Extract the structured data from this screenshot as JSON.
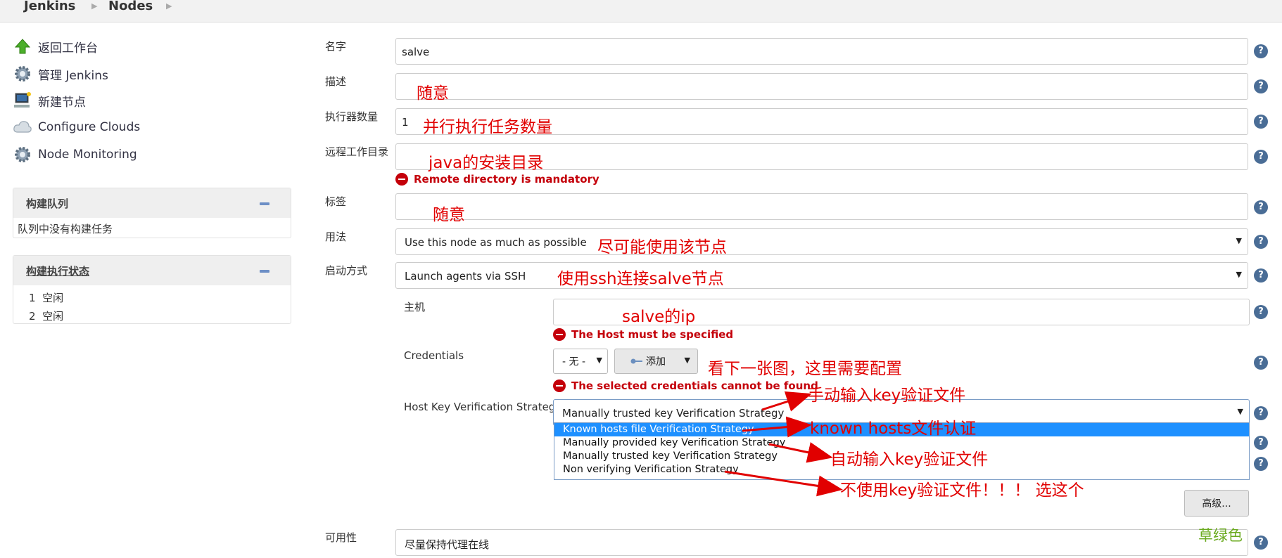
{
  "breadcrumb": {
    "root": "Jenkins",
    "current": "Nodes"
  },
  "sidebar": {
    "items": [
      {
        "label": "返回工作台",
        "icon": "up-arrow-icon"
      },
      {
        "label": "管理 Jenkins",
        "icon": "gear-icon"
      },
      {
        "label": "新建节点",
        "icon": "computer-icon"
      },
      {
        "label": "Configure Clouds",
        "icon": "cloud-icon"
      },
      {
        "label": "Node Monitoring",
        "icon": "gear-icon"
      }
    ],
    "build_queue": {
      "title": "构建队列",
      "empty_text": "队列中没有构建任务"
    },
    "executor_status": {
      "title": "构建执行状态",
      "executors": [
        {
          "num": "1",
          "status": "空闲"
        },
        {
          "num": "2",
          "status": "空闲"
        }
      ]
    }
  },
  "form": {
    "name": {
      "label": "名字",
      "value": "salve"
    },
    "description": {
      "label": "描述",
      "value": ""
    },
    "executors": {
      "label": "执行器数量",
      "value": "1"
    },
    "remote_dir": {
      "label": "远程工作目录",
      "value": "",
      "error": "Remote directory is mandatory"
    },
    "labels": {
      "label": "标签",
      "value": ""
    },
    "usage": {
      "label": "用法",
      "value": "Use this node as much as possible"
    },
    "launch": {
      "label": "启动方式",
      "value": "Launch agents via SSH"
    },
    "host": {
      "label": "主机",
      "value": "",
      "error": "The Host must be specified"
    },
    "credentials": {
      "label": "Credentials",
      "value": "- 无 -",
      "add_label": "添加",
      "error": "The selected credentials cannot be found"
    },
    "host_key": {
      "label": "Host Key Verification Strategy",
      "value": "Manually trusted key Verification Strategy",
      "options": [
        "Known hosts file Verification Strategy",
        "Manually provided key Verification Strategy",
        "Manually trusted key Verification Strategy",
        "Non verifying Verification Strategy"
      ],
      "highlighted_option": 0
    },
    "advanced_label": "高级...",
    "availability": {
      "label": "可用性",
      "value": "尽量保持代理在线"
    }
  },
  "annotations": {
    "description": "随意",
    "executors": "并行执行任务数量",
    "remote_dir": "java的安装目录",
    "labels": "随意",
    "usage": "尽可能使用该节点",
    "launch": "使用ssh连接salve节点",
    "host": "salve的ip",
    "credentials": "看下一张图，这里需要配置",
    "manual_trusted": "手动输入key验证文件",
    "known_hosts": "known hosts文件认证",
    "manual_provided": "自动输入key验证文件",
    "non_verifying": "不使用key验证文件！！！ 选这个",
    "watermark": "草绿色"
  },
  "colors": {
    "annotation": "#e10000",
    "highlight": "#1e90ff",
    "error": "#c4000a",
    "watermark": "#6aaa1e"
  }
}
